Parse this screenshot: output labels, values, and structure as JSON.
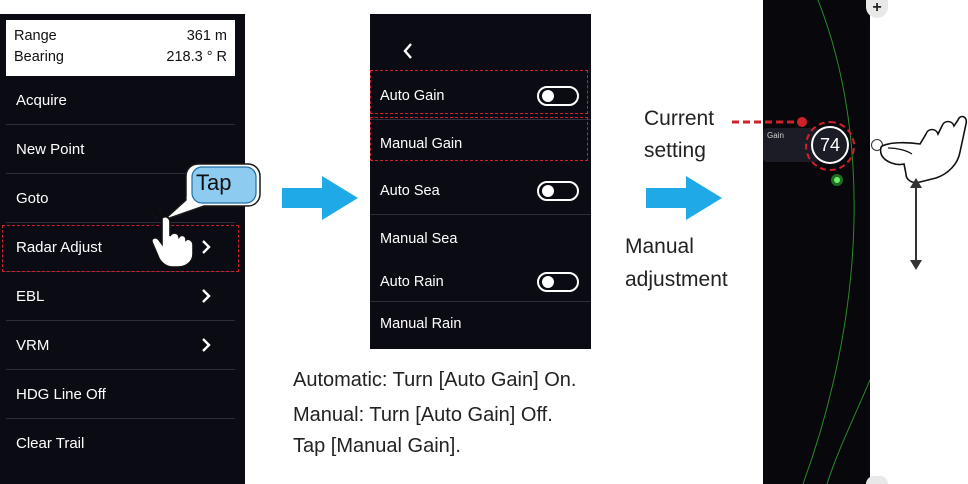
{
  "menu": {
    "range_label": "Range",
    "range_value": "361 m",
    "bearing_label": "Bearing",
    "bearing_value": "218.3 ° R",
    "items": [
      {
        "label": "Acquire"
      },
      {
        "label": "New Point"
      },
      {
        "label": "Goto"
      },
      {
        "label": "Radar Adjust"
      },
      {
        "label": "EBL"
      },
      {
        "label": "VRM"
      },
      {
        "label": "HDG Line Off"
      },
      {
        "label": "Clear Trail"
      }
    ]
  },
  "tap_label": "Tap",
  "radar_adjust": {
    "back_icon": "chevron-left-icon",
    "items": [
      {
        "label": "Auto Gain",
        "toggle": "off"
      },
      {
        "label": "Manual Gain"
      },
      {
        "label": "Auto Sea",
        "toggle": "off"
      },
      {
        "label": "Manual Sea"
      },
      {
        "label": "Auto Rain",
        "toggle": "off"
      },
      {
        "label": "Manual Rain"
      }
    ]
  },
  "instructions": {
    "automatic": "Automatic: Turn [Auto Gain] On.",
    "manual_line1": "Manual: Turn [Auto Gain] Off.",
    "manual_line2": "Tap [Manual Gain]."
  },
  "callouts": {
    "current_line1": "Current",
    "current_line2": "setting",
    "manual_line1": "Manual",
    "manual_line2": "adjustment"
  },
  "gain": {
    "label": "Gain",
    "value": "74",
    "plus": "+"
  },
  "colors": {
    "panel_bg": "#0b0b14",
    "highlight_dash": "#d0202a",
    "arrow_blue": "#1fa9e6"
  }
}
